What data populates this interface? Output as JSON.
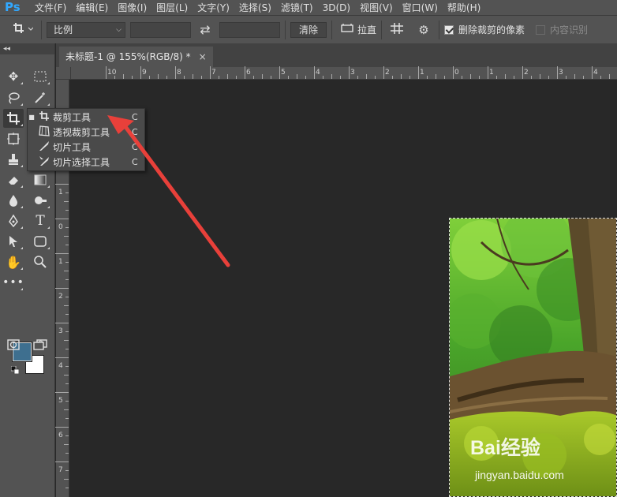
{
  "app": {
    "logo": "Ps"
  },
  "menu": [
    "文件(F)",
    "编辑(E)",
    "图像(I)",
    "图层(L)",
    "文字(Y)",
    "选择(S)",
    "滤镜(T)",
    "3D(D)",
    "视图(V)",
    "窗口(W)",
    "帮助(H)"
  ],
  "options": {
    "ratio_select": "比例",
    "clear_button": "清除",
    "straighten_label": "拉直",
    "delete_cropped_label": "删除裁剪的像素",
    "delete_cropped_checked": true,
    "content_aware_label": "内容识别",
    "content_aware_checked": false
  },
  "document": {
    "tab_title": "未标题-1 @ 155%(RGB/8) *",
    "close": "×"
  },
  "ruler": {
    "top_labels": [
      "10",
      "9",
      "8",
      "7",
      "6",
      "5",
      "4",
      "3",
      "2",
      "1",
      "0",
      "1",
      "2",
      "3",
      "4"
    ],
    "left_labels": [
      "1",
      "0",
      "1",
      "2",
      "3",
      "4",
      "5",
      "6",
      "7"
    ]
  },
  "toolbox": {
    "collapse": "◂◂"
  },
  "flyout": {
    "items": [
      {
        "label": "裁剪工具",
        "key": "C",
        "selected": true,
        "icon": "crop-icon"
      },
      {
        "label": "透视裁剪工具",
        "key": "C",
        "selected": false,
        "icon": "perspective-crop-icon"
      },
      {
        "label": "切片工具",
        "key": "C",
        "selected": false,
        "icon": "slice-icon"
      },
      {
        "label": "切片选择工具",
        "key": "C",
        "selected": false,
        "icon": "slice-select-icon"
      }
    ]
  },
  "colors": {
    "foreground": "#3e6f8f",
    "background": "#ffffff",
    "annotation_arrow": "#e8403a"
  },
  "watermark": {
    "line1": "Bai经验",
    "line2": "jingyan.baidu.com"
  }
}
